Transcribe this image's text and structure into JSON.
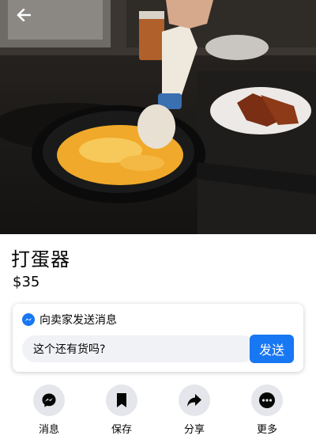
{
  "listing": {
    "title": "打蛋器",
    "price": "$35"
  },
  "message_card": {
    "header_label": "向卖家发送消息",
    "input_value": "这个还有货吗?",
    "send_label": "发送"
  },
  "actions": [
    {
      "label": "消息",
      "icon": "messenger-icon"
    },
    {
      "label": "保存",
      "icon": "bookmark-icon"
    },
    {
      "label": "分享",
      "icon": "share-icon"
    },
    {
      "label": "更多",
      "icon": "more-icon"
    }
  ],
  "colors": {
    "accent": "#1877f2",
    "action_circle": "#e4e6eb",
    "input_bg": "#f0f2f5"
  }
}
